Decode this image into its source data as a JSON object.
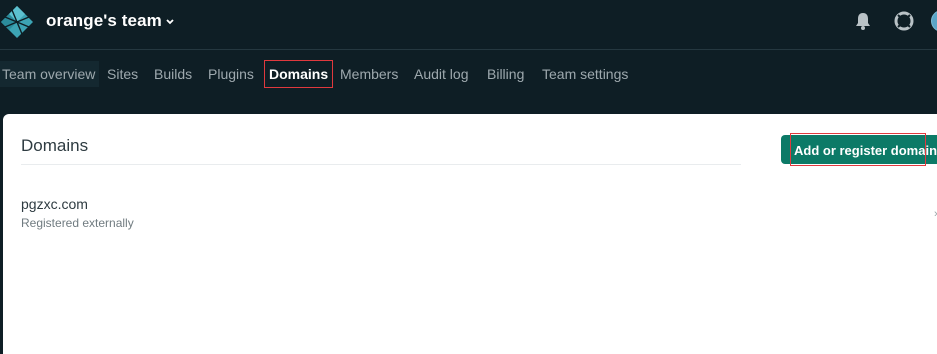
{
  "header": {
    "team_name": "orange's team"
  },
  "nav": {
    "tabs": [
      {
        "label": "Team overview"
      },
      {
        "label": "Sites"
      },
      {
        "label": "Builds"
      },
      {
        "label": "Plugins"
      },
      {
        "label": "Domains",
        "active": true
      },
      {
        "label": "Members"
      },
      {
        "label": "Audit log"
      },
      {
        "label": "Billing"
      },
      {
        "label": "Team settings"
      }
    ]
  },
  "main": {
    "title": "Domains",
    "add_button_label": "Add or register domain",
    "domains": [
      {
        "name": "pgzxc.com",
        "status": "Registered externally"
      }
    ]
  },
  "colors": {
    "background": "#0e1e25",
    "accent": "#0c7a67",
    "highlight": "#e0393e",
    "logo": "#3ca4b4"
  },
  "icons": [
    "netlify-logo-icon",
    "chevron-down-icon",
    "bell-icon",
    "help-lifebuoy-icon",
    "avatar",
    "chevron-right-icon"
  ]
}
